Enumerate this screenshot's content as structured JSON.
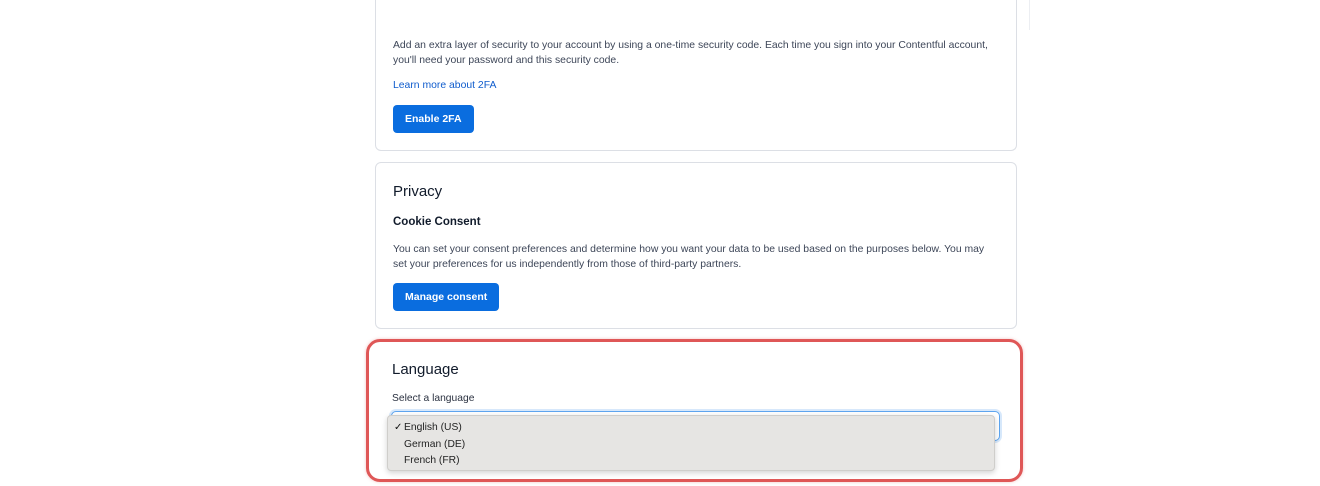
{
  "twofa": {
    "description": "Add an extra layer of security to your account by using a one-time security code. Each time you sign into your Contentful account, you'll need your password and this security code.",
    "learn_more": "Learn more about 2FA",
    "enable_button": "Enable 2FA"
  },
  "privacy": {
    "title": "Privacy",
    "subtitle": "Cookie Consent",
    "description": "You can set your consent preferences and determine how you want your data to be used based on the purposes below. You may set your preferences for us independently from those of third-party partners.",
    "manage_button": "Manage consent"
  },
  "language": {
    "title": "Language",
    "field_label": "Select a language",
    "selected": "English (US)",
    "options": [
      {
        "label": "English (US)",
        "checked": "✓"
      },
      {
        "label": "German (DE)",
        "checked": ""
      },
      {
        "label": "French (FR)",
        "checked": ""
      }
    ]
  },
  "colors": {
    "primary_button": "#0a6ddf",
    "link": "#0f5ccd",
    "highlight_border": "#df5757",
    "focus_ring": "#5ea5ef"
  },
  "icons": {
    "checkmark": "check-icon"
  }
}
